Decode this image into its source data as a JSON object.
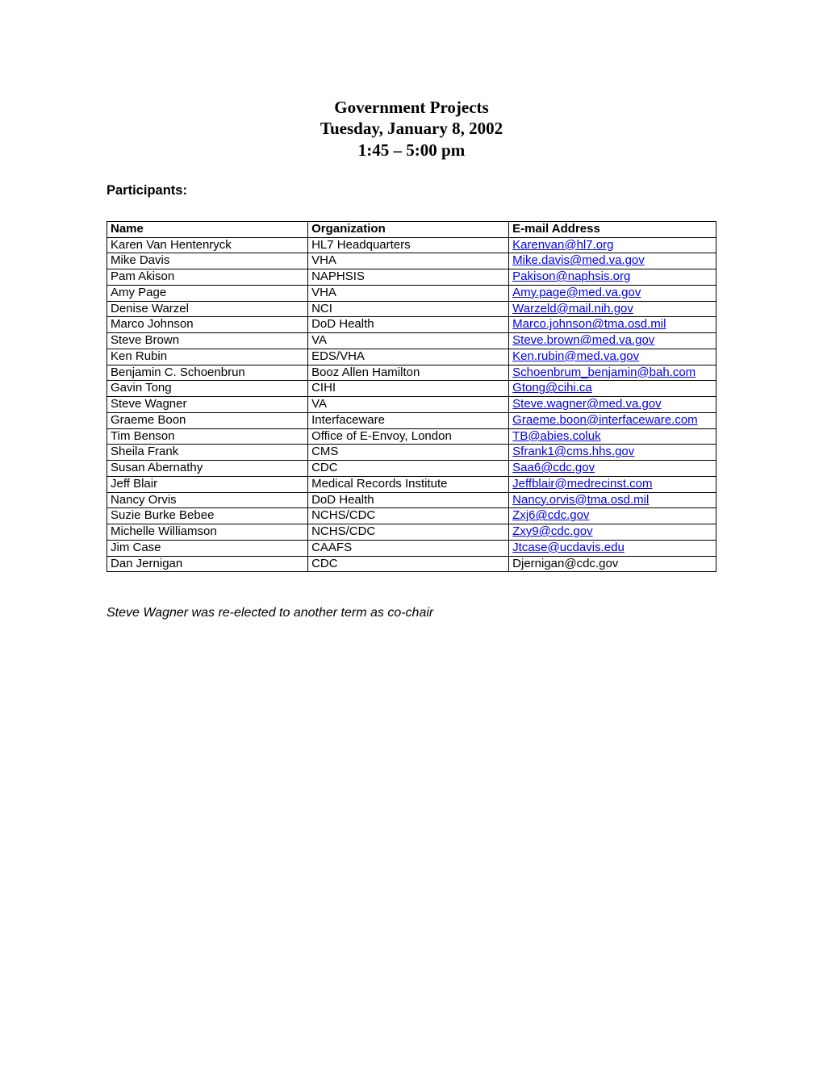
{
  "header": {
    "title": "Government Projects",
    "date": "Tuesday, January 8, 2002",
    "time": "1:45 – 5:00 pm"
  },
  "labels": {
    "participants": "Participants:"
  },
  "table": {
    "headers": {
      "name": "Name",
      "org": "Organization",
      "email": "E-mail Address"
    },
    "rows": [
      {
        "name": "Karen Van Hentenryck",
        "org": "HL7 Headquarters",
        "email": "Karenvan@hl7.org",
        "linked": true
      },
      {
        "name": "Mike Davis",
        "org": "VHA",
        "email": "Mike.davis@med.va.gov",
        "linked": true
      },
      {
        "name": "Pam Akison",
        "org": "NAPHSIS",
        "email": "Pakison@naphsis.org",
        "linked": true
      },
      {
        "name": "Amy Page",
        "org": "VHA",
        "email": "Amy.page@med.va.gov",
        "linked": true
      },
      {
        "name": "Denise Warzel",
        "org": "NCI",
        "email": "Warzeld@mail.nih.gov",
        "linked": true
      },
      {
        "name": "Marco Johnson",
        "org": "DoD Health",
        "email": "Marco.johnson@tma.osd.mil",
        "linked": true
      },
      {
        "name": "Steve Brown",
        "org": "VA",
        "email": "Steve.brown@med.va.gov",
        "linked": true
      },
      {
        "name": "Ken Rubin",
        "org": "EDS/VHA",
        "email": "Ken.rubin@med.va.gov",
        "linked": true
      },
      {
        "name": "Benjamin C. Schoenbrun",
        "org": "Booz Allen Hamilton",
        "email": "Schoenbrum_benjamin@bah.com",
        "linked": true
      },
      {
        "name": "Gavin Tong",
        "org": "CIHI",
        "email": "Gtong@cihi.ca",
        "linked": true
      },
      {
        "name": "Steve Wagner",
        "org": "VA",
        "email": "Steve.wagner@med.va.gov",
        "linked": true
      },
      {
        "name": "Graeme Boon",
        "org": "Interfaceware",
        "email": "Graeme.boon@interfaceware.com",
        "linked": true
      },
      {
        "name": "Tim Benson",
        "org": "Office of E-Envoy, London",
        "email": "TB@abies.coluk",
        "linked": true
      },
      {
        "name": "Sheila Frank",
        "org": "CMS",
        "email": "Sfrank1@cms.hhs.gov",
        "linked": true
      },
      {
        "name": "Susan Abernathy",
        "org": "CDC",
        "email": "Saa6@cdc.gov",
        "linked": true
      },
      {
        "name": "Jeff Blair",
        "org": "Medical Records Institute",
        "email": "Jeffblair@medrecinst.com",
        "linked": true
      },
      {
        "name": "Nancy Orvis",
        "org": "DoD Health",
        "email": "Nancy.orvis@tma.osd.mil",
        "linked": true
      },
      {
        "name": "Suzie Burke Bebee",
        "org": "NCHS/CDC",
        "email": "Zxj6@cdc.gov",
        "linked": true
      },
      {
        "name": "Michelle Williamson",
        "org": "NCHS/CDC",
        "email": "Zxy9@cdc.gov",
        "linked": true
      },
      {
        "name": "Jim Case",
        "org": "CAAFS",
        "email": "Jtcase@ucdavis.edu",
        "linked": true
      },
      {
        "name": "Dan Jernigan",
        "org": "CDC",
        "email": "Djernigan@cdc.gov",
        "linked": false
      }
    ]
  },
  "footnote": "Steve Wagner was re-elected to another term as co-chair"
}
